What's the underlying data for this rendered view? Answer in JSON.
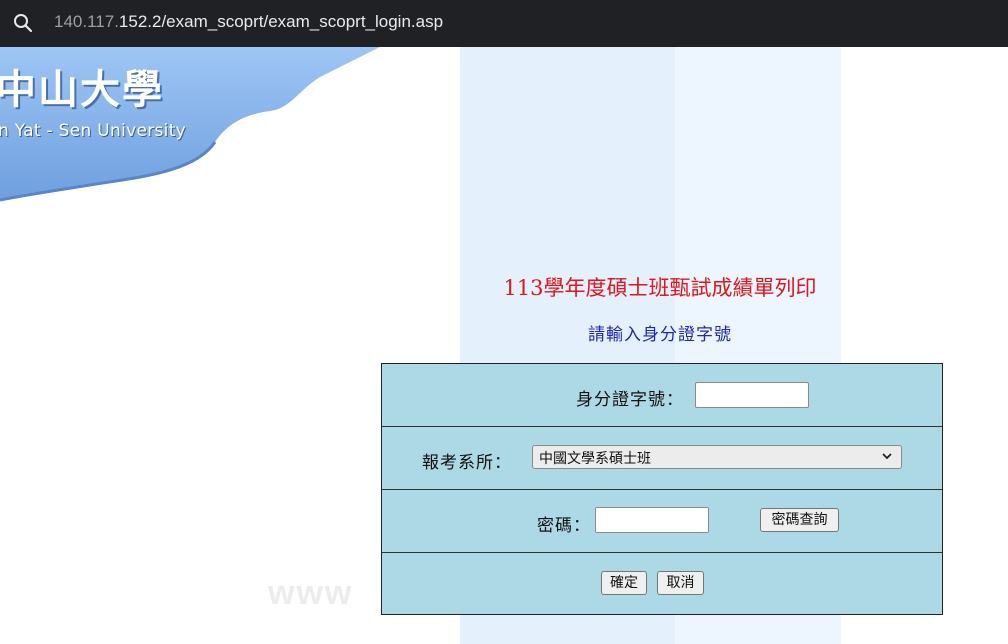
{
  "address_bar": {
    "url_host_dim": "140.117.",
    "url_rest": "152.2/exam_scoprt/exam_scoprt_login.asp",
    "search_icon": "search-icon"
  },
  "logo": {
    "chinese": "中山大學",
    "english": "n Yat - Sen University"
  },
  "watermark": "www",
  "page": {
    "title": "113學年度碩士班甄試成績單列印",
    "subtitle": "請輸入身分證字號"
  },
  "form": {
    "id_label": "身分證字號：",
    "id_value": "",
    "dept_label": "報考系所：",
    "dept_selected": "中國文學系碩士班",
    "password_label": "密碼：",
    "password_value": "",
    "password_query_button": "密碼查詢",
    "confirm_button": "確定",
    "cancel_button": "取消"
  },
  "colors": {
    "title": "#e0161c",
    "subtitle": "#1f27b8",
    "form_bg": "#add8e6",
    "address_bar_bg": "#202124"
  }
}
